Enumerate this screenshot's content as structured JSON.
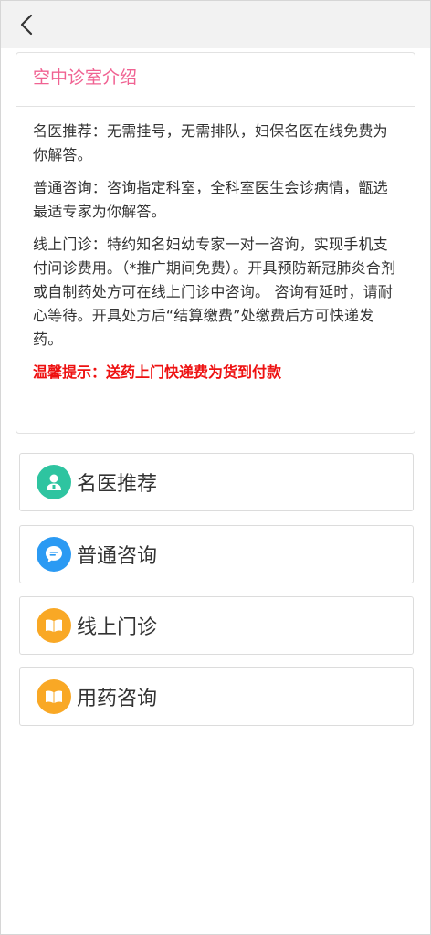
{
  "nav": {
    "back_icon": "chevron-left-icon"
  },
  "intro": {
    "title": "空中诊室介绍",
    "paragraphs": [
      "名医推荐：无需挂号，无需排队，妇保名医在线免费为你解答。",
      "普通咨询：咨询指定科室，全科室医生会诊病情，甑选最适专家为你解答。",
      "线上门诊：特约知名妇幼专家一对一咨询，实现手机支付问诊费用。（*推广期间免费）。开具预防新冠肺炎合剂或自制药处方可在线上门诊中咨询。 咨询有延时，请耐心等待。开具处方后“结算缴费”处缴费后方可快递发药。"
    ],
    "tip": "温馨提示：送药上门快递费为货到付款"
  },
  "menu": [
    {
      "label": "名医推荐",
      "icon": "doctor-icon",
      "color": "#2ec4a0"
    },
    {
      "label": "普通咨询",
      "icon": "chat-bubble-icon",
      "color": "#2b9af3"
    },
    {
      "label": "线上门诊",
      "icon": "book-icon",
      "color": "#f9a825"
    },
    {
      "label": "用药咨询",
      "icon": "book-icon",
      "color": "#f9a825"
    }
  ],
  "colors": {
    "title_pink": "#f06292",
    "tip_red": "#ee1111"
  }
}
